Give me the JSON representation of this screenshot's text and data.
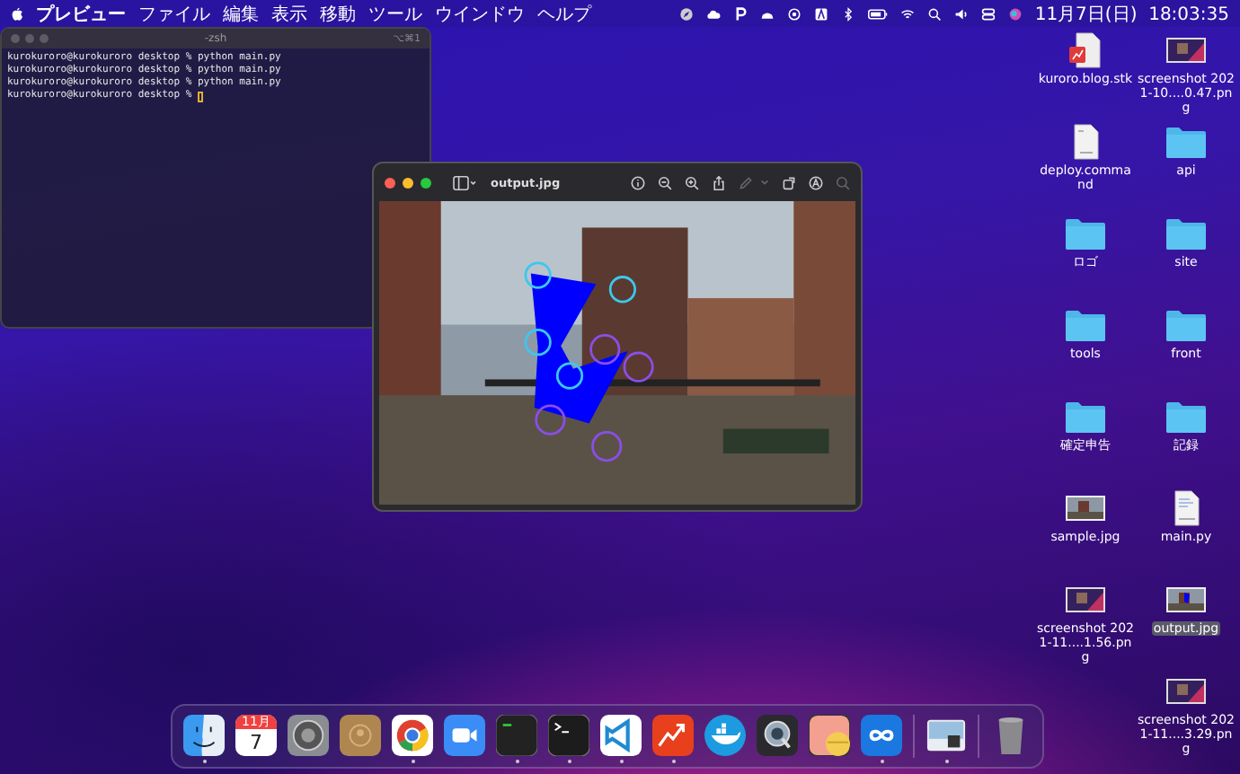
{
  "menu_bar": {
    "app_name": "プレビュー",
    "menus": [
      "ファイル",
      "編集",
      "表示",
      "移動",
      "ツール",
      "ウインドウ",
      "ヘルプ"
    ],
    "clock": "11月7日(日)  18:03:35"
  },
  "terminal": {
    "title": "-zsh",
    "shortcut": "⌥⌘1",
    "lines": [
      "kurokuroro@kurokuroro desktop % python main.py",
      "kurokuroro@kurokuroro desktop % python main.py",
      "kurokuroro@kurokuroro desktop % python main.py"
    ],
    "prompt": "kurokuroro@kurokuroro desktop %"
  },
  "preview": {
    "title": "output.jpg"
  },
  "desktop_items": [
    {
      "label": "kuroro.blog.stk",
      "kind": "stk",
      "selected": false
    },
    {
      "label": "screenshot 2021-10....0.47.png",
      "kind": "screenshot",
      "selected": false
    },
    {
      "label": "deploy.command",
      "kind": "shell",
      "selected": false
    },
    {
      "label": "api",
      "kind": "folder",
      "selected": false
    },
    {
      "label": "ロゴ",
      "kind": "folder",
      "selected": false
    },
    {
      "label": "site",
      "kind": "folder",
      "selected": false
    },
    {
      "label": "tools",
      "kind": "folder",
      "selected": false
    },
    {
      "label": "front",
      "kind": "folder",
      "selected": false
    },
    {
      "label": "確定申告",
      "kind": "folder",
      "selected": false
    },
    {
      "label": "記録",
      "kind": "folder",
      "selected": false
    },
    {
      "label": "sample.jpg",
      "kind": "photo",
      "selected": false
    },
    {
      "label": "main.py",
      "kind": "python",
      "selected": false
    },
    {
      "label": "screenshot 2021-11....1.56.png",
      "kind": "screenshot",
      "selected": false
    },
    {
      "label": "output.jpg",
      "kind": "photo",
      "selected": true
    },
    {
      "label": "screenshot 2021-11....3.29.png",
      "kind": "screenshot",
      "selected": false
    }
  ],
  "dock": {
    "apps": [
      {
        "kind": "finder",
        "running": true
      },
      {
        "kind": "calendar",
        "running": false,
        "month": "11月",
        "day": "7"
      },
      {
        "kind": "settings",
        "running": false
      },
      {
        "kind": "contacts",
        "running": false
      },
      {
        "kind": "browser",
        "running": true
      },
      {
        "kind": "video",
        "running": false
      },
      {
        "kind": "console",
        "running": true
      },
      {
        "kind": "terminal",
        "running": true
      },
      {
        "kind": "editor",
        "running": true
      },
      {
        "kind": "chart",
        "running": true
      },
      {
        "kind": "whale",
        "running": false
      },
      {
        "kind": "player",
        "running": false
      },
      {
        "kind": "pill",
        "running": false
      },
      {
        "kind": "infinity",
        "running": true
      },
      {
        "kind": "sep"
      },
      {
        "kind": "image",
        "running": true
      },
      {
        "kind": "sep"
      },
      {
        "kind": "trash",
        "running": false
      }
    ]
  }
}
